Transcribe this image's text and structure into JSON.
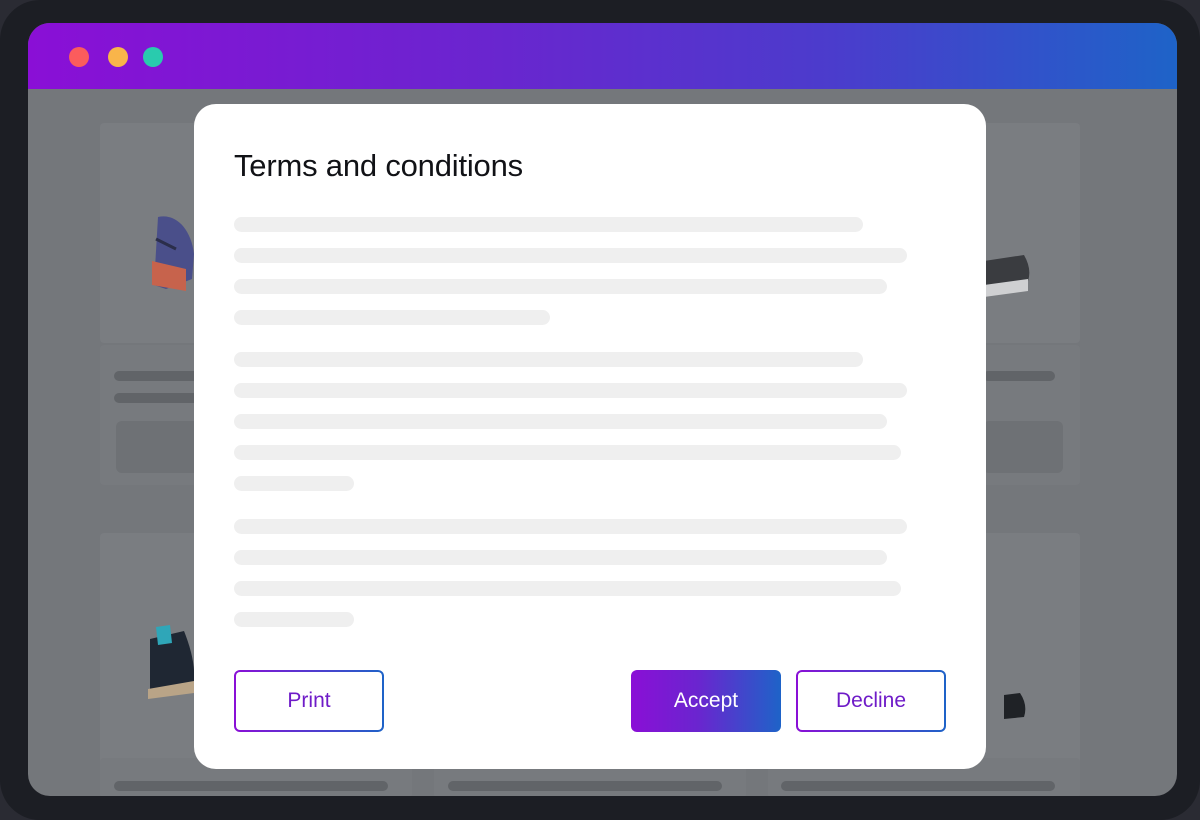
{
  "window": {
    "controls": [
      "close",
      "minimize",
      "maximize"
    ]
  },
  "dialog": {
    "title": "Terms and conditions",
    "buttons": {
      "print": "Print",
      "accept": "Accept",
      "decline": "Decline"
    }
  },
  "colors": {
    "accent_start": "#8a0fd6",
    "accent_end": "#1e63c8",
    "overlay": "#74777b"
  }
}
